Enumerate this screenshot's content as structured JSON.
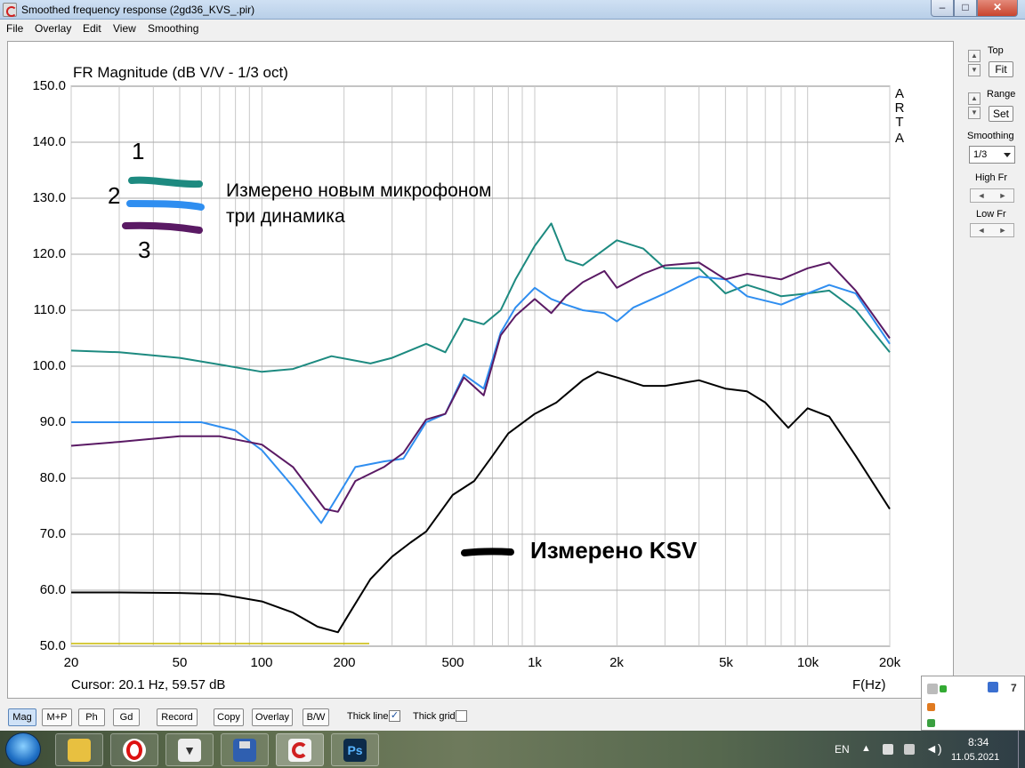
{
  "window": {
    "title": "Smoothed frequency response (2gd36_KVS_.pir)",
    "controls": {
      "minimize": "–",
      "maximize": "□",
      "close": "✕"
    }
  },
  "menu": [
    "File",
    "Overlay",
    "Edit",
    "View",
    "Smoothing"
  ],
  "plot": {
    "y_axis_title": "FR Magnitude (dB V/V - 1/3 oct)",
    "y_ticks": [
      "150.0",
      "140.0",
      "130.0",
      "120.0",
      "110.0",
      "100.0",
      "90.0",
      "80.0",
      "70.0",
      "60.0",
      "50.0"
    ],
    "x_ticks": [
      "20",
      "50",
      "100",
      "200",
      "500",
      "1k",
      "2k",
      "5k",
      "10k",
      "20k"
    ],
    "x_unit_label": "F(Hz)",
    "watermark_letters": [
      "A",
      "R",
      "T",
      "A"
    ],
    "cursor_readout": "Cursor: 20.1 Hz, 59.57 dB"
  },
  "annotations": {
    "num1": "1",
    "num2": "2",
    "num3": "3",
    "legend_line1": "Измерено новым микрофоном",
    "legend_line2": "три динамика",
    "ksv_label": "Измерено KSV"
  },
  "colors": {
    "curve1": "#1d8a80",
    "curve2": "#2f8ef0",
    "curve3": "#5a1a64",
    "curve_ksv": "#000000",
    "grid": "#c8c8c8",
    "baseline": "#c8b800"
  },
  "chart_data": {
    "type": "line",
    "title": "",
    "xlabel": "F(Hz)",
    "ylabel": "FR Magnitude (dB V/V - 1/3 oct)",
    "xscale": "log",
    "xlim": [
      20,
      20000
    ],
    "ylim": [
      50,
      150
    ],
    "grid": true,
    "series": [
      {
        "name": "1",
        "color": "#1d8a80",
        "x": [
          20,
          30,
          50,
          70,
          100,
          130,
          180,
          250,
          300,
          400,
          470,
          550,
          650,
          750,
          850,
          1000,
          1150,
          1300,
          1500,
          2000,
          2500,
          3000,
          4000,
          5000,
          6000,
          7000,
          8000,
          10000,
          12000,
          15000,
          20000
        ],
        "y": [
          102.8,
          102.5,
          101.5,
          100.3,
          99.0,
          99.5,
          101.8,
          100.5,
          101.5,
          104.0,
          102.5,
          108.5,
          107.5,
          110.0,
          115.5,
          121.5,
          125.5,
          119.0,
          118.0,
          122.5,
          121.0,
          117.5,
          117.5,
          113.0,
          114.5,
          113.5,
          112.5,
          113.0,
          113.5,
          110.0,
          102.5
        ]
      },
      {
        "name": "2",
        "color": "#2f8ef0",
        "x": [
          20,
          40,
          60,
          80,
          100,
          130,
          165,
          180,
          220,
          280,
          330,
          400,
          470,
          550,
          650,
          750,
          850,
          1000,
          1150,
          1300,
          1500,
          1800,
          2000,
          2300,
          3000,
          4000,
          5000,
          6000,
          8000,
          10000,
          12000,
          15000,
          20000
        ],
        "y": [
          90.0,
          90.0,
          90.0,
          88.5,
          85.0,
          78.5,
          72.0,
          75.0,
          82.0,
          83.0,
          83.5,
          90.0,
          91.5,
          98.5,
          96.0,
          106.0,
          110.5,
          114.0,
          112.0,
          111.0,
          110.0,
          109.5,
          108.0,
          110.5,
          113.0,
          116.0,
          115.5,
          112.5,
          111.0,
          113.0,
          114.5,
          113.0,
          104.0
        ]
      },
      {
        "name": "3",
        "color": "#5a1a64",
        "x": [
          20,
          30,
          50,
          70,
          100,
          130,
          170,
          190,
          220,
          280,
          330,
          400,
          470,
          550,
          650,
          750,
          850,
          1000,
          1150,
          1300,
          1500,
          1800,
          2000,
          2500,
          3000,
          4000,
          5000,
          6000,
          8000,
          10000,
          12000,
          15000,
          20000
        ],
        "y": [
          85.8,
          86.5,
          87.5,
          87.5,
          86.0,
          82.0,
          74.5,
          74.0,
          79.5,
          82.0,
          84.5,
          90.5,
          91.5,
          98.0,
          94.8,
          105.5,
          109.0,
          112.0,
          109.5,
          112.5,
          115.0,
          117.0,
          114.0,
          116.5,
          118.0,
          118.5,
          115.5,
          116.5,
          115.5,
          117.5,
          118.5,
          113.5,
          105.0
        ]
      },
      {
        "name": "Измерено KSV",
        "color": "#000000",
        "x": [
          20,
          30,
          50,
          70,
          100,
          130,
          160,
          190,
          210,
          250,
          300,
          350,
          400,
          500,
          600,
          700,
          800,
          1000,
          1200,
          1500,
          1700,
          2000,
          2500,
          3000,
          4000,
          5000,
          6000,
          7000,
          8500,
          10000,
          12000,
          15000,
          20000
        ],
        "y": [
          59.6,
          59.6,
          59.5,
          59.3,
          58.0,
          56.0,
          53.5,
          52.5,
          56.0,
          62.0,
          66.0,
          68.5,
          70.5,
          77.0,
          79.5,
          84.0,
          88.0,
          91.5,
          93.5,
          97.5,
          99.0,
          98.0,
          96.5,
          96.5,
          97.5,
          96.0,
          95.5,
          93.5,
          89.0,
          92.5,
          91.0,
          84.0,
          74.5
        ]
      }
    ]
  },
  "sidebar": {
    "top_label": "Top",
    "fit_button": "Fit",
    "range_label": "Range",
    "set_button": "Set",
    "smoothing_label": "Smoothing",
    "smoothing_value": "1/3",
    "high_fr_label": "High Fr",
    "low_fr_label": "Low Fr"
  },
  "bottom": {
    "buttons": [
      "Mag",
      "M+P",
      "Ph",
      "Gd",
      "Record",
      "Copy",
      "Overlay",
      "B/W"
    ],
    "thick_line_label": "Thick line",
    "thick_line_checked": "✓",
    "thick_grid_label": "Thick grid"
  },
  "tray_popup": {
    "count": "7"
  },
  "taskbar": {
    "language": "EN",
    "time": "8:34",
    "date": "11.05.2021",
    "apps": [
      "file-explorer",
      "opera",
      "media-player",
      "save",
      "arta",
      "photoshop"
    ],
    "ps_label": "Ps"
  }
}
